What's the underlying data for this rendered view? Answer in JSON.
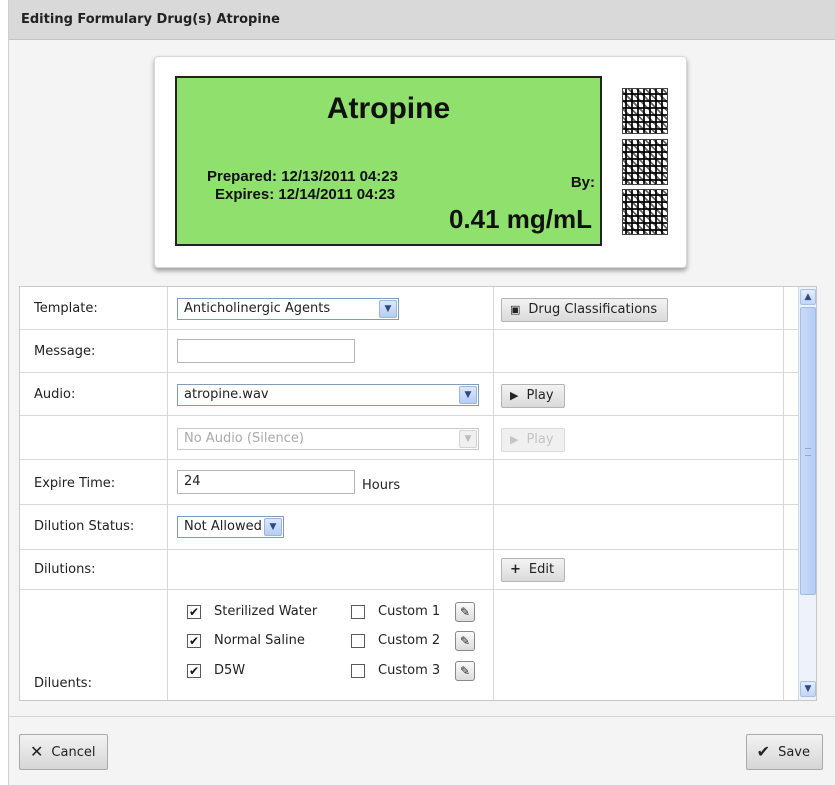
{
  "window": {
    "title": "Editing Formulary Drug(s) Atropine"
  },
  "label_preview": {
    "drug_name": "Atropine",
    "prepared": "Prepared: 12/13/2011 04:23",
    "expires": "Expires: 12/14/2011 04:23",
    "by": "By:",
    "concentration": "0.41 mg/mL",
    "background_color": "#8fe06c"
  },
  "form": {
    "template": {
      "label": "Template:",
      "value": "Anticholinergic Agents",
      "button": "Drug Classifications"
    },
    "message": {
      "label": "Message:",
      "value": ""
    },
    "audio": {
      "label": "Audio:",
      "value": "atropine.wav",
      "play": "Play"
    },
    "audio2": {
      "value": "No Audio (Silence)",
      "play": "Play"
    },
    "expire_time": {
      "label": "Expire Time:",
      "value": "24",
      "unit": "Hours"
    },
    "dilution_status": {
      "label": "Dilution Status:",
      "value": "Not Allowed"
    },
    "dilutions": {
      "label": "Dilutions:",
      "button": "Edit"
    },
    "diluents": {
      "label": "Diluents:",
      "standard": [
        {
          "label": "Sterilized Water",
          "checked": true
        },
        {
          "label": "Normal Saline",
          "checked": true
        },
        {
          "label": "D5W",
          "checked": true
        }
      ],
      "custom": [
        {
          "label": "Custom 1",
          "checked": false
        },
        {
          "label": "Custom 2",
          "checked": false
        },
        {
          "label": "Custom 3",
          "checked": false
        }
      ]
    }
  },
  "footer": {
    "cancel": "Cancel",
    "save": "Save"
  },
  "icons": {
    "cancel": "close-icon",
    "save": "checkmark-icon",
    "play": "play-icon",
    "edit": "plus-icon",
    "classifications": "image-icon",
    "custom_edit": "pencil-icon"
  }
}
